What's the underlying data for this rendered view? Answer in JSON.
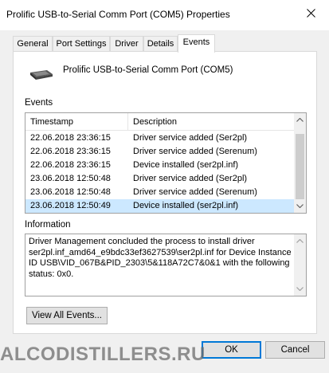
{
  "window": {
    "title": "Prolific USB-to-Serial Comm Port (COM5) Properties"
  },
  "tabs": [
    {
      "label": "General"
    },
    {
      "label": "Port Settings"
    },
    {
      "label": "Driver"
    },
    {
      "label": "Details"
    },
    {
      "label": "Events"
    }
  ],
  "active_tab": "Events",
  "device": {
    "name": "Prolific USB-to-Serial Comm Port (COM5)",
    "icon": "usb-serial-port-icon"
  },
  "events": {
    "label": "Events",
    "columns": [
      "Timestamp",
      "Description"
    ],
    "rows": [
      {
        "timestamp": "22.06.2018 23:36:15",
        "description": "Driver service added (Ser2pl)"
      },
      {
        "timestamp": "22.06.2018 23:36:15",
        "description": "Driver service added (Serenum)"
      },
      {
        "timestamp": "22.06.2018 23:36:15",
        "description": "Device installed (ser2pl.inf)"
      },
      {
        "timestamp": "23.06.2018 12:50:48",
        "description": "Driver service added (Ser2pl)"
      },
      {
        "timestamp": "23.06.2018 12:50:48",
        "description": "Driver service added (Serenum)"
      },
      {
        "timestamp": "23.06.2018 12:50:49",
        "description": "Device installed (ser2pl.inf)"
      }
    ],
    "selected_index": 5
  },
  "information": {
    "label": "Information",
    "text": "Driver Management concluded the process to install driver\nser2pl.inf_amd64_e9bdc33ef3627539\\ser2pl.inf for Device Instance\nID USB\\VID_067B&PID_2303\\5&118A72C7&0&1 with the following\nstatus: 0x0."
  },
  "buttons": {
    "view_all_events": "View All Events...",
    "ok": "OK",
    "cancel": "Cancel"
  },
  "watermark": "ALCODISTILLERS.RU",
  "colors": {
    "selection": "#cce8ff",
    "default_button_border": "#0078d7"
  }
}
